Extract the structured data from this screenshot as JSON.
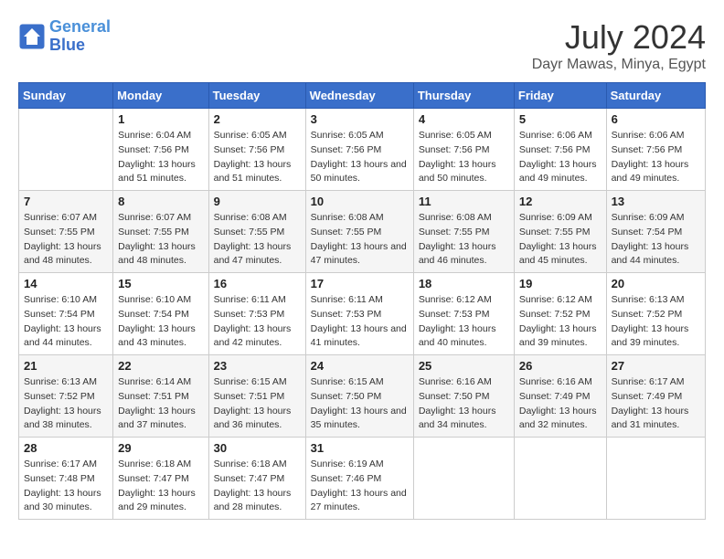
{
  "logo": {
    "line1": "General",
    "line2": "Blue"
  },
  "title": "July 2024",
  "location": "Dayr Mawas, Minya, Egypt",
  "weekdays": [
    "Sunday",
    "Monday",
    "Tuesday",
    "Wednesday",
    "Thursday",
    "Friday",
    "Saturday"
  ],
  "weeks": [
    [
      null,
      {
        "day": "1",
        "sunrise": "6:04 AM",
        "sunset": "7:56 PM",
        "daylight": "13 hours and 51 minutes."
      },
      {
        "day": "2",
        "sunrise": "6:05 AM",
        "sunset": "7:56 PM",
        "daylight": "13 hours and 51 minutes."
      },
      {
        "day": "3",
        "sunrise": "6:05 AM",
        "sunset": "7:56 PM",
        "daylight": "13 hours and 50 minutes."
      },
      {
        "day": "4",
        "sunrise": "6:05 AM",
        "sunset": "7:56 PM",
        "daylight": "13 hours and 50 minutes."
      },
      {
        "day": "5",
        "sunrise": "6:06 AM",
        "sunset": "7:56 PM",
        "daylight": "13 hours and 49 minutes."
      },
      {
        "day": "6",
        "sunrise": "6:06 AM",
        "sunset": "7:56 PM",
        "daylight": "13 hours and 49 minutes."
      }
    ],
    [
      {
        "day": "7",
        "sunrise": "6:07 AM",
        "sunset": "7:55 PM",
        "daylight": "13 hours and 48 minutes."
      },
      {
        "day": "8",
        "sunrise": "6:07 AM",
        "sunset": "7:55 PM",
        "daylight": "13 hours and 48 minutes."
      },
      {
        "day": "9",
        "sunrise": "6:08 AM",
        "sunset": "7:55 PM",
        "daylight": "13 hours and 47 minutes."
      },
      {
        "day": "10",
        "sunrise": "6:08 AM",
        "sunset": "7:55 PM",
        "daylight": "13 hours and 47 minutes."
      },
      {
        "day": "11",
        "sunrise": "6:08 AM",
        "sunset": "7:55 PM",
        "daylight": "13 hours and 46 minutes."
      },
      {
        "day": "12",
        "sunrise": "6:09 AM",
        "sunset": "7:55 PM",
        "daylight": "13 hours and 45 minutes."
      },
      {
        "day": "13",
        "sunrise": "6:09 AM",
        "sunset": "7:54 PM",
        "daylight": "13 hours and 44 minutes."
      }
    ],
    [
      {
        "day": "14",
        "sunrise": "6:10 AM",
        "sunset": "7:54 PM",
        "daylight": "13 hours and 44 minutes."
      },
      {
        "day": "15",
        "sunrise": "6:10 AM",
        "sunset": "7:54 PM",
        "daylight": "13 hours and 43 minutes."
      },
      {
        "day": "16",
        "sunrise": "6:11 AM",
        "sunset": "7:53 PM",
        "daylight": "13 hours and 42 minutes."
      },
      {
        "day": "17",
        "sunrise": "6:11 AM",
        "sunset": "7:53 PM",
        "daylight": "13 hours and 41 minutes."
      },
      {
        "day": "18",
        "sunrise": "6:12 AM",
        "sunset": "7:53 PM",
        "daylight": "13 hours and 40 minutes."
      },
      {
        "day": "19",
        "sunrise": "6:12 AM",
        "sunset": "7:52 PM",
        "daylight": "13 hours and 39 minutes."
      },
      {
        "day": "20",
        "sunrise": "6:13 AM",
        "sunset": "7:52 PM",
        "daylight": "13 hours and 39 minutes."
      }
    ],
    [
      {
        "day": "21",
        "sunrise": "6:13 AM",
        "sunset": "7:52 PM",
        "daylight": "13 hours and 38 minutes."
      },
      {
        "day": "22",
        "sunrise": "6:14 AM",
        "sunset": "7:51 PM",
        "daylight": "13 hours and 37 minutes."
      },
      {
        "day": "23",
        "sunrise": "6:15 AM",
        "sunset": "7:51 PM",
        "daylight": "13 hours and 36 minutes."
      },
      {
        "day": "24",
        "sunrise": "6:15 AM",
        "sunset": "7:50 PM",
        "daylight": "13 hours and 35 minutes."
      },
      {
        "day": "25",
        "sunrise": "6:16 AM",
        "sunset": "7:50 PM",
        "daylight": "13 hours and 34 minutes."
      },
      {
        "day": "26",
        "sunrise": "6:16 AM",
        "sunset": "7:49 PM",
        "daylight": "13 hours and 32 minutes."
      },
      {
        "day": "27",
        "sunrise": "6:17 AM",
        "sunset": "7:49 PM",
        "daylight": "13 hours and 31 minutes."
      }
    ],
    [
      {
        "day": "28",
        "sunrise": "6:17 AM",
        "sunset": "7:48 PM",
        "daylight": "13 hours and 30 minutes."
      },
      {
        "day": "29",
        "sunrise": "6:18 AM",
        "sunset": "7:47 PM",
        "daylight": "13 hours and 29 minutes."
      },
      {
        "day": "30",
        "sunrise": "6:18 AM",
        "sunset": "7:47 PM",
        "daylight": "13 hours and 28 minutes."
      },
      {
        "day": "31",
        "sunrise": "6:19 AM",
        "sunset": "7:46 PM",
        "daylight": "13 hours and 27 minutes."
      },
      null,
      null,
      null
    ]
  ]
}
